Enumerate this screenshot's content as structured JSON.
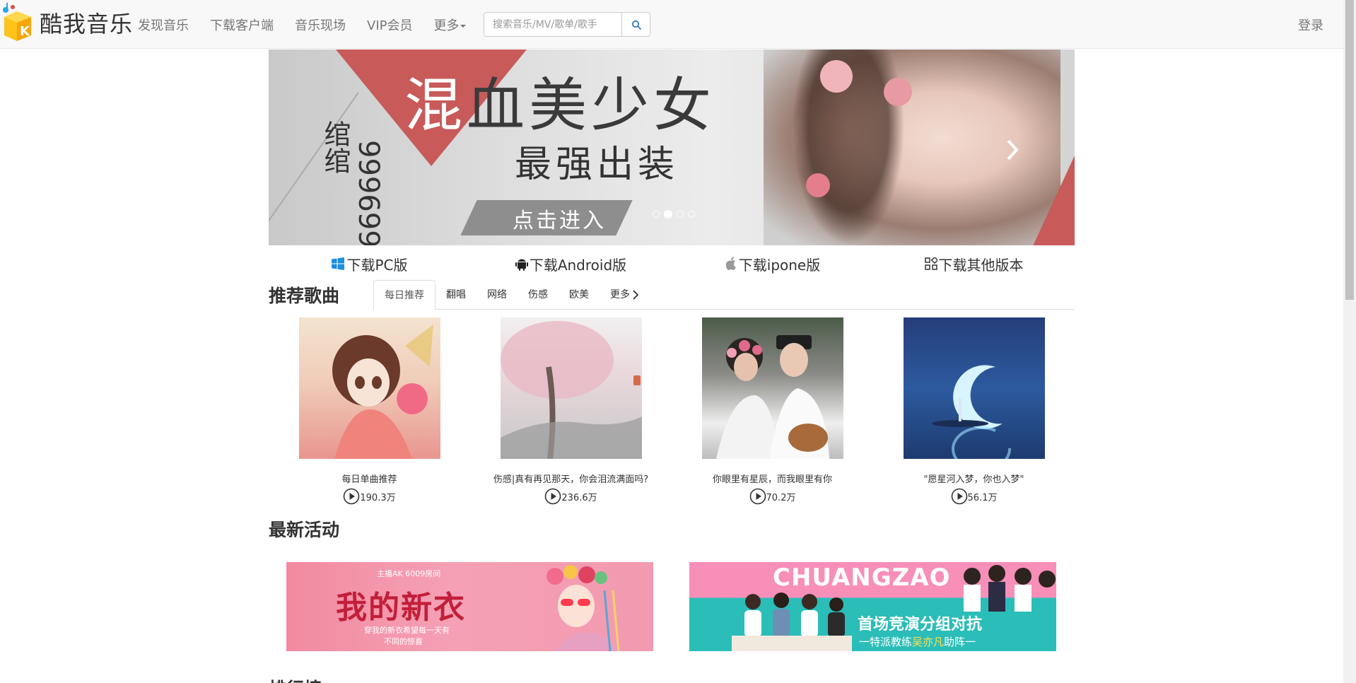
{
  "brand": {
    "name": "酷我音乐"
  },
  "nav": {
    "links": [
      "发现音乐",
      "下载客户端",
      "音乐现场",
      "VIP会员"
    ],
    "more_label": "更多"
  },
  "search": {
    "placeholder": "搜索音乐/MV/歌单/歌手"
  },
  "header": {
    "login_label": "登录"
  },
  "banner": {
    "title_first": "混",
    "title_rest": "血美少女",
    "subtitle": "最强出装",
    "vertical_name": "绾绾",
    "vertical_number": "999699",
    "button_label": "点击进入",
    "active_dot": 1
  },
  "downloads": [
    {
      "label": "下载PC版",
      "icon": "windows-icon"
    },
    {
      "label": "下载Android版",
      "icon": "android-icon"
    },
    {
      "label": "下载ipone版",
      "icon": "apple-icon"
    },
    {
      "label": "下载其他版本",
      "icon": "grid-icon"
    }
  ],
  "recommend": {
    "title": "推荐歌曲",
    "tabs": [
      "每日推荐",
      "翻唱",
      "网络",
      "伤感",
      "欧美"
    ],
    "more_label": "更多",
    "items": [
      {
        "title": "每日单曲推荐",
        "plays": "190.3万"
      },
      {
        "title": "伤感|真有再见那天，你会泪流满面吗?",
        "plays": "236.6万"
      },
      {
        "title": "你眼里有星辰，而我眼里有你",
        "plays": "70.2万"
      },
      {
        "title": "\"愿星河入梦，你也入梦\"",
        "plays": "56.1万"
      }
    ]
  },
  "activities": {
    "title": "最新活动",
    "items": [
      {
        "top": "主播AK 6009房间",
        "title": "我的新衣",
        "sub1": "穿我的新衣希望每一天有",
        "sub2": "不同的惊喜"
      },
      {
        "top": "CHUANGZAO",
        "main": "首场竞演分组对抗",
        "sub_pre": "一特派教练",
        "sub_hl": "吴亦凡",
        "sub_post": "助阵一"
      }
    ]
  },
  "next_section": {
    "title": "排行榜"
  }
}
